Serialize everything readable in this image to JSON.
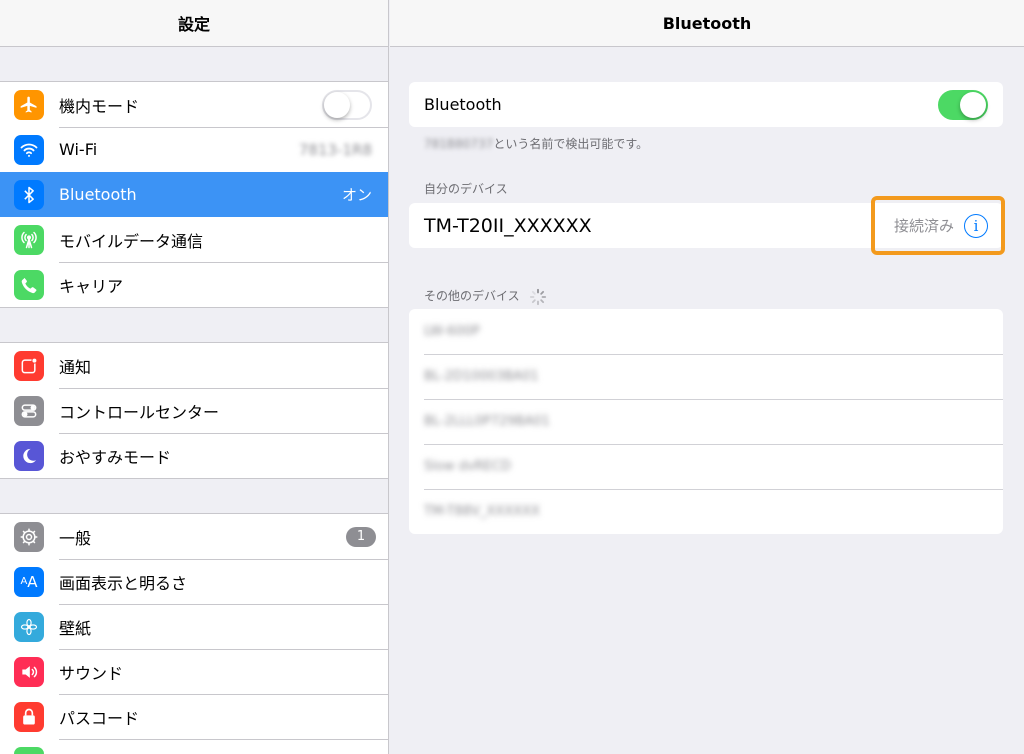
{
  "left": {
    "title": "設定",
    "groups": [
      [
        {
          "label": "機内モード",
          "icon": "airplane-icon",
          "color": "#ff9500",
          "toggle": "off"
        },
        {
          "label": "Wi-Fi",
          "icon": "wifi-icon",
          "color": "#007aff",
          "value": "7813-1R8"
        },
        {
          "label": "Bluetooth",
          "icon": "bluetooth-icon",
          "color": "#007aff",
          "value": "オン",
          "selected": true
        },
        {
          "label": "モバイルデータ通信",
          "icon": "antenna-icon",
          "color": "#4cd964"
        },
        {
          "label": "キャリア",
          "icon": "phone-icon",
          "color": "#4cd964"
        }
      ],
      [
        {
          "label": "通知",
          "icon": "notification-icon",
          "color": "#ff3b30"
        },
        {
          "label": "コントロールセンター",
          "icon": "control-center-icon",
          "color": "#8e8e93"
        },
        {
          "label": "おやすみモード",
          "icon": "moon-icon",
          "color": "#5856d6"
        }
      ],
      [
        {
          "label": "一般",
          "icon": "gear-icon",
          "color": "#8e8e93",
          "badge": "1"
        },
        {
          "label": "画面表示と明るさ",
          "icon": "text-size-icon",
          "color": "#007aff"
        },
        {
          "label": "壁紙",
          "icon": "flower-icon",
          "color": "#34aadc"
        },
        {
          "label": "サウンド",
          "icon": "speaker-icon",
          "color": "#ff2d55"
        },
        {
          "label": "パスコード",
          "icon": "lock-icon",
          "color": "#ff3b30"
        }
      ]
    ]
  },
  "right": {
    "title": "Bluetooth",
    "bluetooth_label": "Bluetooth",
    "bluetooth_toggle": "on",
    "discoverable_name": "781B80737",
    "discoverable_suffix": "という名前で検出可能です。",
    "my_devices_caption": "自分のデバイス",
    "my_device": {
      "name": "TM-T20II_XXXXXX",
      "status": "接続済み"
    },
    "other_devices_caption": "その他のデバイス",
    "other_devices": [
      "LW-600P",
      "BL-2D10003BA01",
      "BL-2LLL0P729BA01",
      "Slow dvRECD",
      "TM-T88V_XXXXXX"
    ]
  },
  "colors": {
    "accent": "#007aff",
    "selected_row": "#3c93f5",
    "toggle_on": "#4cd964",
    "highlight": "#f39a1d"
  }
}
